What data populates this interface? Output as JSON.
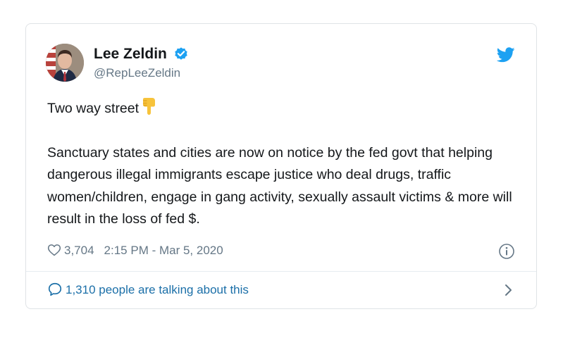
{
  "tweet": {
    "author": {
      "display_name": "Lee Zeldin",
      "handle": "@RepLeeZeldin",
      "verified": true
    },
    "text_line1": "Two way street",
    "text_paragraph2": "Sanctuary states and cities are now on notice by the fed govt that helping dangerous illegal immigrants escape justice who deal drugs, traffic women/children, engage in gang activity, sexually assault victims & more will result in the loss of fed $.",
    "emoji": "backhand-index-pointing-down",
    "likes": "3,704",
    "timestamp": "2:15 PM - Mar 5, 2020",
    "talking_about": "1,310 people are talking about this"
  },
  "icons": {
    "verified": "verified-badge-icon",
    "platform": "twitter-bird-icon",
    "like": "heart-icon",
    "info": "info-icon",
    "reply": "speech-bubble-icon",
    "chevron": "chevron-right-icon"
  },
  "colors": {
    "brand_blue": "#1da1f2",
    "link_blue": "#1b6fa8",
    "text": "#14171a",
    "secondary_text": "#657786",
    "border": "#dfe3e6"
  }
}
